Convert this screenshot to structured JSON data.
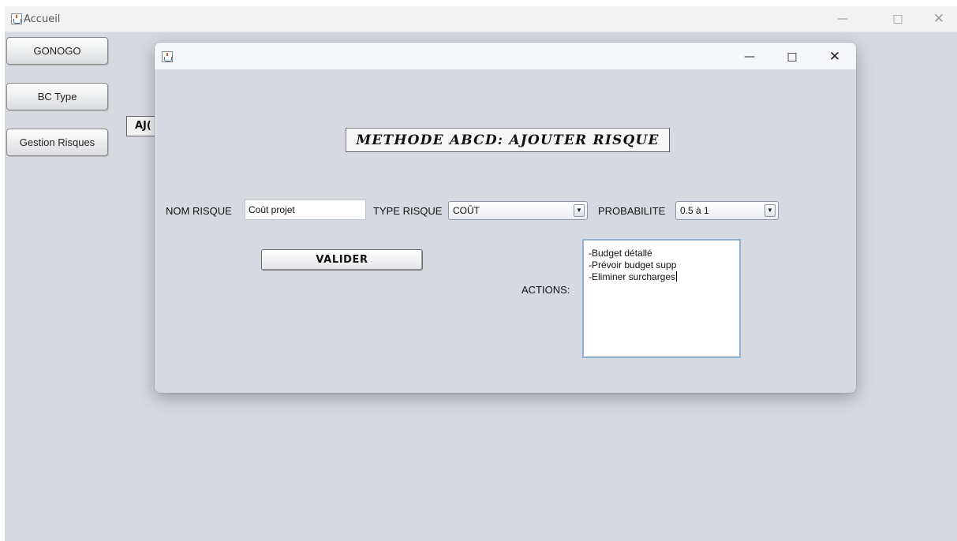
{
  "main_window": {
    "title": "Accueil",
    "sidebar": [
      {
        "label": "GONOGO"
      },
      {
        "label": "BC Type"
      },
      {
        "label": "Gestion Risques"
      }
    ],
    "partial_button_label": "AJ("
  },
  "dialog": {
    "title": "",
    "heading": "METHODE ABCD: AJOUTER RISQUE",
    "form": {
      "nom_risque_label": "NOM RISQUE",
      "nom_risque_value": "Coût projet",
      "type_risque_label": "TYPE RISQUE",
      "type_risque_value": "COÛT",
      "probabilite_label": "PROBABILITE",
      "probabilite_value": "0.5 à 1",
      "valider_label": "VALIDER",
      "actions_label": "ACTIONS:",
      "actions_lines": [
        "-Budget détallé",
        "-Prévoir budget supp",
        "-Eliminer surcharges"
      ]
    }
  },
  "icons": {
    "window_icon": "java-cup-icon",
    "minimize": "minimize-icon",
    "maximize": "maximize-icon",
    "close": "close-icon",
    "dropdown": "chevron-down-icon"
  }
}
